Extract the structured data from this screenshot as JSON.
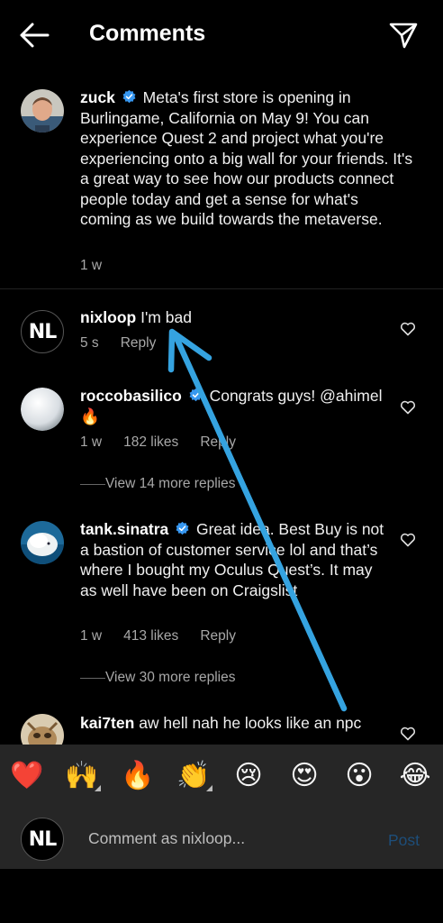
{
  "header": {
    "title": "Comments",
    "back_icon": "arrow-left-icon",
    "share_icon": "paper-plane-icon"
  },
  "caption": {
    "username": "zuck",
    "verified": true,
    "text": "Meta's first store is opening in Burlingame, California on May 9! You can experience Quest 2 and project what you're experiencing onto a big wall for your friends. It's a great way to see how our products connect people today and get a sense for what's coming as we build towards the metaverse.",
    "time": "1 w"
  },
  "comments": [
    {
      "username": "nixloop",
      "verified": false,
      "text": "I'm bad",
      "time": "5 s",
      "likes": "",
      "reply_label": "Reply"
    },
    {
      "username": "roccobasilico",
      "verified": true,
      "text": "Congrats guys! @ahimel 🔥",
      "time": "1 w",
      "likes": "182 likes",
      "reply_label": "Reply",
      "view_replies": "View 14 more replies"
    },
    {
      "username": "tank.sinatra",
      "verified": true,
      "text": "Great idea. Best Buy is not a bastion of customer service lol and that’s where I bought my Oculus Quest’s. It may as well have been on Craigslist",
      "time": "1 w",
      "likes": "413 likes",
      "reply_label": "Reply",
      "view_replies": "View 30 more replies"
    },
    {
      "username": "kai7ten",
      "verified": false,
      "text": "aw hell nah he looks like an npc",
      "time": "",
      "likes": "",
      "reply_label": ""
    }
  ],
  "emoji_bar": [
    "❤️",
    "🙌",
    "🔥",
    "👏",
    "😢",
    "😍",
    "😮",
    "😂"
  ],
  "composer": {
    "avatar_initials": "NL",
    "placeholder": "Comment as nixloop...",
    "post_label": "Post"
  },
  "colors": {
    "background": "#000000",
    "verified": "#3797f0",
    "annotation_arrow": "#35a3e0",
    "post_disabled": "#1d4e7a"
  }
}
